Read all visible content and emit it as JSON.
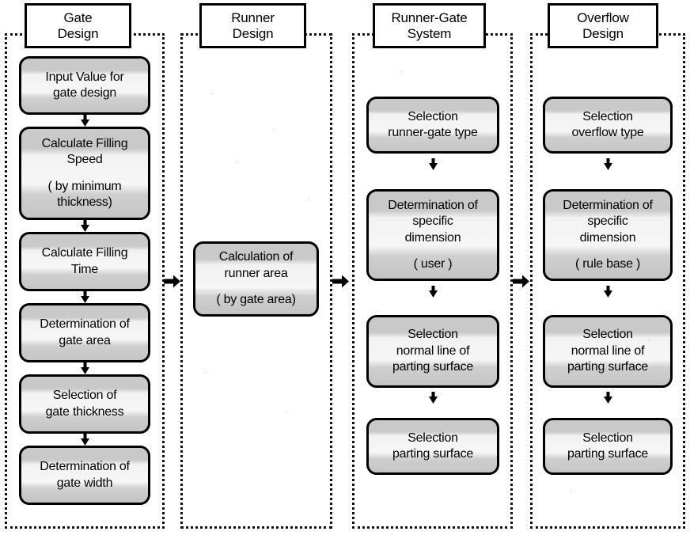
{
  "figure": {
    "kind": "flowchart",
    "orientation": "left-to-right stages, top-to-bottom steps",
    "stage_count": 4
  },
  "stages": [
    {
      "id": "gate-design",
      "title_lines": [
        "Gate",
        "Design"
      ],
      "steps": [
        {
          "lines": [
            "Input Value for",
            "gate design"
          ],
          "paren_lines": []
        },
        {
          "lines": [
            "Calculate Filling",
            "Speed"
          ],
          "paren_lines": [
            "( by minimum",
            "thickness)"
          ]
        },
        {
          "lines": [
            "Calculate Filling",
            "Time"
          ],
          "paren_lines": []
        },
        {
          "lines": [
            "Determination of",
            "gate area"
          ],
          "paren_lines": []
        },
        {
          "lines": [
            "Selection of",
            "gate thickness"
          ],
          "paren_lines": []
        },
        {
          "lines": [
            "Determination of",
            "gate width"
          ],
          "paren_lines": []
        }
      ]
    },
    {
      "id": "runner-design",
      "title_lines": [
        "Runner",
        "Design"
      ],
      "steps": [
        {
          "lines": [
            "Calculation of",
            "runner area"
          ],
          "paren_lines": [
            "( by gate area)"
          ]
        }
      ]
    },
    {
      "id": "runner-gate-system",
      "title_lines": [
        "Runner-Gate",
        "System"
      ],
      "steps": [
        {
          "lines": [
            "Selection",
            "runner-gate type"
          ],
          "paren_lines": []
        },
        {
          "lines": [
            "Determination of",
            "specific",
            "dimension"
          ],
          "paren_lines": [
            "( user )"
          ]
        },
        {
          "lines": [
            "Selection",
            "normal line of",
            "parting surface"
          ],
          "paren_lines": []
        },
        {
          "lines": [
            "Selection",
            "parting surface"
          ],
          "paren_lines": []
        }
      ]
    },
    {
      "id": "overflow-design",
      "title_lines": [
        "Overflow",
        "Design"
      ],
      "steps": [
        {
          "lines": [
            "Selection",
            "overflow type"
          ],
          "paren_lines": []
        },
        {
          "lines": [
            "Determination of",
            "specific",
            "dimension"
          ],
          "paren_lines": [
            "( rule base )"
          ]
        },
        {
          "lines": [
            "Selection",
            "normal line of",
            "parting surface"
          ],
          "paren_lines": []
        },
        {
          "lines": [
            "Selection",
            "parting surface"
          ],
          "paren_lines": []
        }
      ]
    }
  ],
  "connectors": {
    "between_stages": [
      "gate-design -> runner-design",
      "runner-design -> runner-gate-system",
      "runner-gate-system -> overflow-design"
    ],
    "arrow_glyph": "arrow-down-icon",
    "stage_arrow_glyph": "arrow-right-icon"
  },
  "colors": {
    "outline": "#000000",
    "box_fill_light": "#f5f5f5",
    "box_fill_shade": "#c7c7c7",
    "page_background": "#ffffff"
  }
}
